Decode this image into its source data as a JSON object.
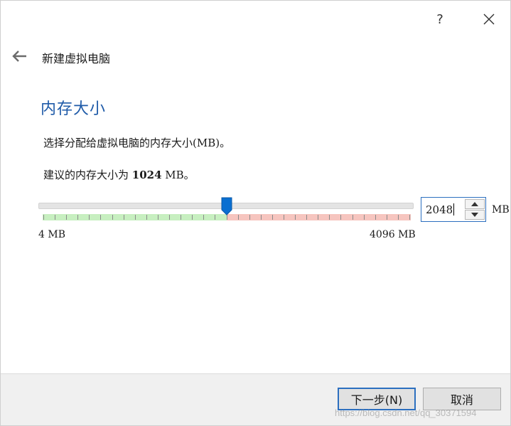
{
  "titlebar": {
    "help_label": "?"
  },
  "header": {
    "title": "新建虚拟电脑"
  },
  "section": {
    "title": "内存大小",
    "description": "选择分配给虚拟电脑的内存大小(MB)。",
    "recommend_prefix": "建议的内存大小为 ",
    "recommend_value": "1024",
    "recommend_suffix": " MB。"
  },
  "memory": {
    "min_label": "4 MB",
    "max_label": "4096 MB",
    "min_mb": 4,
    "max_mb": 4096,
    "recommended_mb": 1024,
    "safe_limit_mb": 2048,
    "value": "2048",
    "value_mb": 2048,
    "unit": "MB"
  },
  "footer": {
    "next_label": "下一步(N)",
    "cancel_label": "取消"
  },
  "watermark": "https://blog.csdn.net/qq_30371594",
  "colors": {
    "accent": "#1e5aa8",
    "focus_border": "#2c6fbf",
    "safe_zone": "#c7efc0",
    "danger_zone": "#f6c5bf",
    "thumb": "#0a6fd1"
  }
}
